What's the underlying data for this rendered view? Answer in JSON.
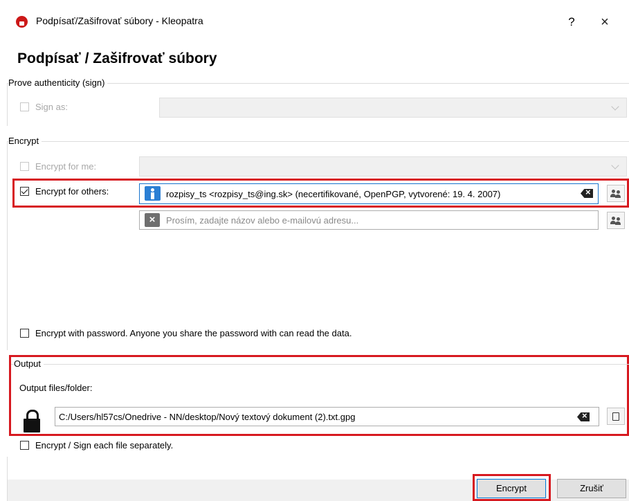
{
  "window": {
    "title": "Podpísať/Zašifrovať súbory - Kleopatra",
    "help_label": "?",
    "close_label": "×"
  },
  "page_title": "Podpísať / Zašifrovať súbory",
  "sign_group": {
    "title": "Prove authenticity (sign)",
    "sign_as_label": "Sign as:",
    "sign_as_checked": false,
    "sign_as_enabled": false
  },
  "encrypt_group": {
    "title": "Encrypt",
    "encrypt_for_me_label": "Encrypt for me:",
    "encrypt_for_me_checked": false,
    "encrypt_for_others_label": "Encrypt for others:",
    "encrypt_for_others_checked": true,
    "recipient_value": "rozpisy_ts <rozpisy_ts@ing.sk> (necertifikované, OpenPGP, vytvorené: 19. 4. 2007)",
    "recipient_placeholder": "Prosím, zadajte názov alebo e-mailovú adresu...",
    "password_label": "Encrypt with password. Anyone you share the password with can read the data.",
    "password_checked": false
  },
  "output_group": {
    "title": "Output",
    "files_folder_label": "Output files/folder:",
    "output_path": "C:/Users/hl57cs/Onedrive - NN/desktop/Nový textový dokument (2).txt.gpg",
    "separately_label": "Encrypt / Sign each file separately.",
    "separately_checked": false
  },
  "buttons": {
    "encrypt": "Encrypt",
    "cancel": "Zrušiť"
  },
  "colors": {
    "highlight_red": "#d71920",
    "kleopatra_red": "#cc1818",
    "cert_blue": "#2b7fd4",
    "focus_blue": "#1874cd"
  },
  "icons": [
    "kleopatra-app-icon",
    "certificate-icon",
    "invalid-x-icon",
    "clear-icon",
    "add-people-icon",
    "lock-icon",
    "open-file-icon"
  ]
}
